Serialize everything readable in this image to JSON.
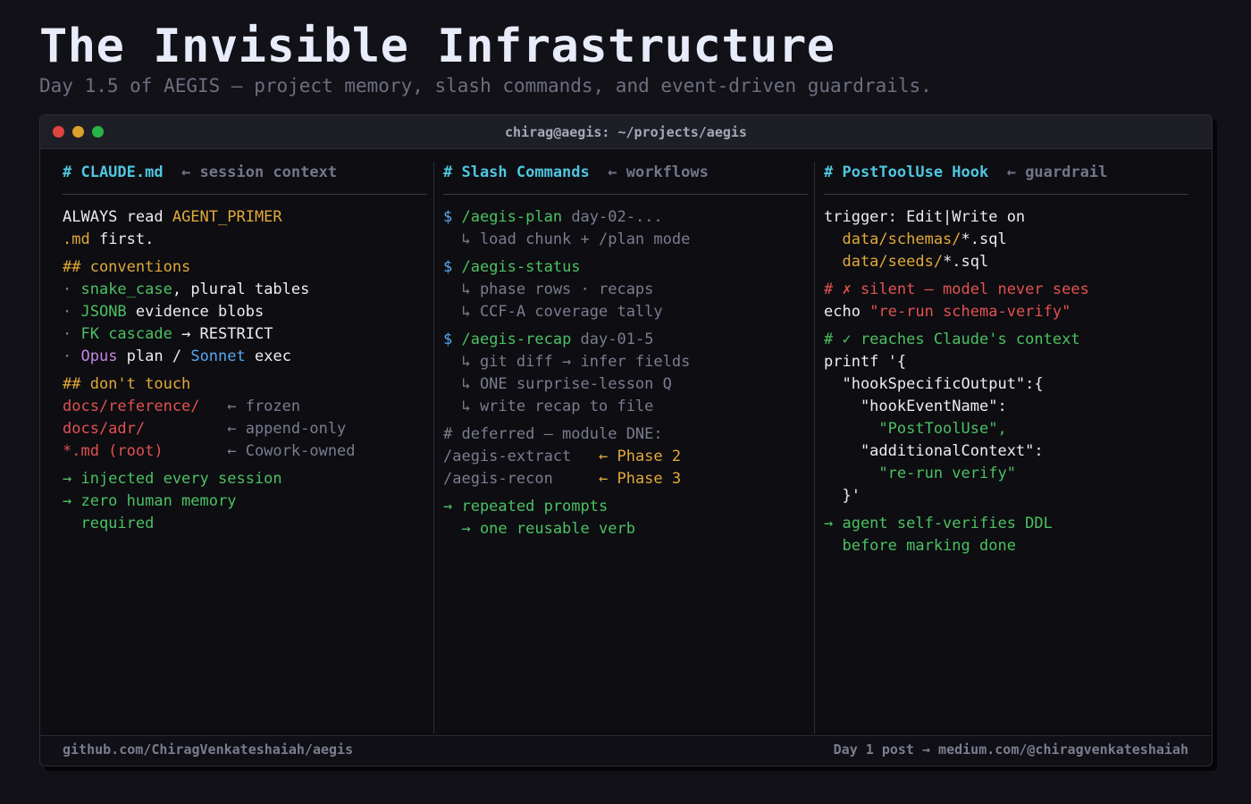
{
  "header": {
    "title": "The Invisible Infrastructure",
    "subtitle": "Day 1.5 of AEGIS — project memory, slash commands, and event-driven guardrails."
  },
  "window": {
    "title": "chirag@aegis: ~/projects/aegis",
    "controls": [
      "close",
      "minimize",
      "maximize"
    ]
  },
  "colors": {
    "background": "#121117",
    "heading": "#4fc6de",
    "accent_yellow": "#e2a93a",
    "accent_green": "#4cc161",
    "accent_red": "#e2524f",
    "muted": "#7a7d8e",
    "purple": "#c487e3",
    "blue": "#5aa6ee"
  },
  "panels": [
    {
      "heading": "# CLAUDE.md",
      "subheading": "← session context",
      "lines": [
        [
          {
            "t": "ALWAYS read ",
            "c": "w"
          },
          {
            "t": "AGENT_PRIMER",
            "c": "y"
          }
        ],
        [
          {
            "t": ".md",
            "c": "y"
          },
          {
            "t": " first.",
            "c": "w"
          }
        ],
        "gap",
        [
          {
            "t": "## conventions",
            "c": "y"
          }
        ],
        [
          {
            "t": "· ",
            "c": "m"
          },
          {
            "t": "snake_case",
            "c": "g"
          },
          {
            "t": ", plural tables",
            "c": "w"
          }
        ],
        [
          {
            "t": "· ",
            "c": "m"
          },
          {
            "t": "JSONB",
            "c": "g"
          },
          {
            "t": " evidence blobs",
            "c": "w"
          }
        ],
        [
          {
            "t": "· ",
            "c": "m"
          },
          {
            "t": "FK cascade",
            "c": "g"
          },
          {
            "t": " → RESTRICT",
            "c": "w"
          }
        ],
        [
          {
            "t": "· ",
            "c": "m"
          },
          {
            "t": "Opus",
            "c": "p"
          },
          {
            "t": " plan / ",
            "c": "w"
          },
          {
            "t": "Sonnet",
            "c": "b"
          },
          {
            "t": " exec",
            "c": "w"
          }
        ],
        "gap",
        [
          {
            "t": "## don't touch",
            "c": "y"
          }
        ],
        [
          {
            "t": "docs/reference/",
            "c": "r"
          },
          {
            "t": "   ← frozen",
            "c": "m"
          }
        ],
        [
          {
            "t": "docs/adr/",
            "c": "r"
          },
          {
            "t": "         ← append-only",
            "c": "m"
          }
        ],
        [
          {
            "t": "*.md (root)",
            "c": "r"
          },
          {
            "t": "       ← Cowork-owned",
            "c": "m"
          }
        ],
        "gap",
        [
          {
            "t": "→ injected every session",
            "c": "g"
          }
        ],
        [
          {
            "t": "→ zero human memory",
            "c": "g"
          }
        ],
        [
          {
            "t": "  required",
            "c": "g"
          }
        ]
      ]
    },
    {
      "heading": "# Slash Commands",
      "subheading": "← workflows",
      "lines": [
        [
          {
            "t": "$ ",
            "c": "b"
          },
          {
            "t": "/aegis-plan",
            "c": "g"
          },
          {
            "t": " day-02-...",
            "c": "m"
          }
        ],
        [
          {
            "t": "  ↳ load chunk + /plan mode",
            "c": "m"
          }
        ],
        "gap",
        [
          {
            "t": "$ ",
            "c": "b"
          },
          {
            "t": "/aegis-status",
            "c": "g"
          }
        ],
        [
          {
            "t": "  ↳ phase rows · recaps",
            "c": "m"
          }
        ],
        [
          {
            "t": "  ↳ CCF-A coverage tally",
            "c": "m"
          }
        ],
        "gap",
        [
          {
            "t": "$ ",
            "c": "b"
          },
          {
            "t": "/aegis-recap",
            "c": "g"
          },
          {
            "t": " day-01-5",
            "c": "m"
          }
        ],
        [
          {
            "t": "  ↳ git diff → infer fields",
            "c": "m"
          }
        ],
        [
          {
            "t": "  ↳ ONE surprise-lesson Q",
            "c": "m"
          }
        ],
        [
          {
            "t": "  ↳ write recap to file",
            "c": "m"
          }
        ],
        "gap",
        [
          {
            "t": "# deferred — module DNE:",
            "c": "m"
          }
        ],
        [
          {
            "t": "/aegis-extract",
            "c": "m"
          },
          {
            "t": "   ← Phase 2",
            "c": "y"
          }
        ],
        [
          {
            "t": "/aegis-recon",
            "c": "m"
          },
          {
            "t": "     ← Phase 3",
            "c": "y"
          }
        ],
        "gap",
        [
          {
            "t": "→ repeated prompts",
            "c": "g"
          }
        ],
        [
          {
            "t": "  → one reusable verb",
            "c": "g"
          }
        ]
      ]
    },
    {
      "heading": "# PostToolUse Hook",
      "subheading": "← guardrail",
      "lines": [
        [
          {
            "t": "trigger: Edit|Write on",
            "c": "w"
          }
        ],
        [
          {
            "t": "  data/schemas/",
            "c": "y"
          },
          {
            "t": "*.sql",
            "c": "w"
          }
        ],
        [
          {
            "t": "  data/seeds/",
            "c": "y"
          },
          {
            "t": "*.sql",
            "c": "w"
          }
        ],
        "gap",
        [
          {
            "t": "# ✗ silent — model never sees",
            "c": "r"
          }
        ],
        [
          {
            "t": "echo ",
            "c": "w"
          },
          {
            "t": "\"re-run schema-verify\"",
            "c": "r"
          }
        ],
        "gap",
        [
          {
            "t": "# ✓ reaches Claude's context",
            "c": "g"
          }
        ],
        [
          {
            "t": "printf '{",
            "c": "w"
          }
        ],
        [
          {
            "t": "  \"hookSpecificOutput\":{",
            "c": "w"
          }
        ],
        [
          {
            "t": "    \"hookEventName\":",
            "c": "w"
          }
        ],
        [
          {
            "t": "      \"PostToolUse\",",
            "c": "g"
          }
        ],
        [
          {
            "t": "    \"additionalContext\":",
            "c": "w"
          }
        ],
        [
          {
            "t": "      \"re-run verify\"",
            "c": "g"
          }
        ],
        [
          {
            "t": "  }'",
            "c": "w"
          }
        ],
        "gap",
        [
          {
            "t": "→ agent self-verifies DDL",
            "c": "g"
          }
        ],
        [
          {
            "t": "  before marking done",
            "c": "g"
          }
        ]
      ]
    }
  ],
  "footer": {
    "left": "github.com/ChiragVenkateshaiah/aegis",
    "right": "Day 1 post → medium.com/@chiragvenkateshaiah"
  }
}
